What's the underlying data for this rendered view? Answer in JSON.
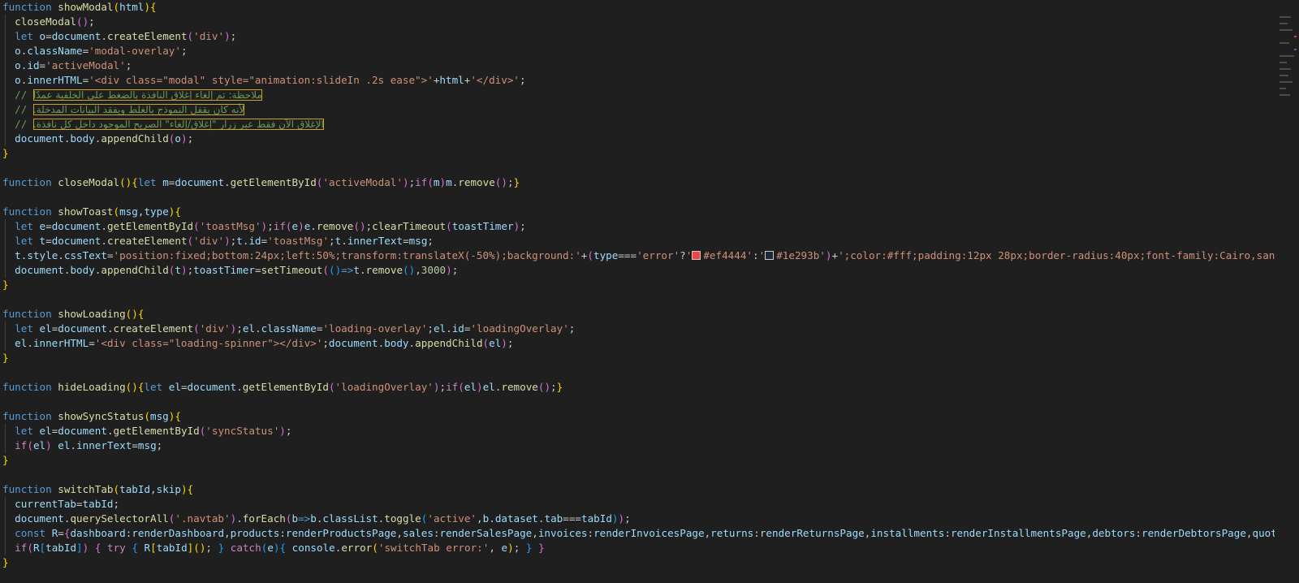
{
  "editor": {
    "language": "javascript",
    "lines": [
      "function showModal(html){",
      "  closeModal();",
      "  let o=document.createElement('div');",
      "  o.className='modal-overlay';",
      "  o.id='activeModal';",
      "  o.innerHTML='<div class=\"modal\" style=\"animation:slideIn .2s ease\">'+html+'</div>';",
      "  // ملاحظة: تم إلغاء إغلاق النافذة بالضغط على الخلفية عمدًا",
      "  // لأنه كان يقفل النموذج بالغلط ويفقد البيانات المدخلة.",
      "  // الإغلاق الآن فقط عبر زرار \"إغلاق/إلغاء\" الصريح الموجود داخل كل نافذة.",
      "  document.body.appendChild(o);",
      "}",
      "",
      "function closeModal(){let m=document.getElementById('activeModal');if(m)m.remove();}",
      "",
      "function showToast(msg,type){",
      "  let e=document.getElementById('toastMsg');if(e)e.remove();clearTimeout(toastTimer);",
      "  let t=document.createElement('div');t.id='toastMsg';t.innerText=msg;",
      "  t.style.cssText='position:fixed;bottom:24px;left:50%;transform:translateX(-50%);background:'+(type==='error'?'#ef4444':'#1e293b')+';color:#fff;padding:12px 28px;border-radius:40px;font-family:Cairo,sans-serif;fo",
      "  document.body.appendChild(t);toastTimer=setTimeout(()=>t.remove(),3000);",
      "}",
      "",
      "function showLoading(){",
      "  let el=document.createElement('div');el.className='loading-overlay';el.id='loadingOverlay';",
      "  el.innerHTML='<div class=\"loading-spinner\"></div>';document.body.appendChild(el);",
      "}",
      "",
      "function hideLoading(){let el=document.getElementById('loadingOverlay');if(el)el.remove();}",
      "",
      "function showSyncStatus(msg){",
      "  let el=document.getElementById('syncStatus');",
      "  if(el) el.innerText=msg;",
      "}",
      "",
      "function switchTab(tabId,skip){",
      "  currentTab=tabId;",
      "  document.querySelectorAll('.navtab').forEach(b=>b.classList.toggle('active',b.dataset.tab===tabId));",
      "  const R={dashboard:renderDashboard,products:renderProductsPage,sales:renderSalesPage,invoices:renderInvoicesPage,returns:renderReturnsPage,installments:renderInstallmentsPage,debtors:renderDebtorsPage,quotes:renderQ",
      "  if(R[tabId]) { try { R[tabId](); } catch(e){ console.error('switchTab error:', e); } }",
      "}"
    ],
    "color_swatches": {
      "error": "#ef4444",
      "default": "#1e293b"
    },
    "theme": {
      "background": "#1f1f1f",
      "keyword": "#569cd6",
      "control": "#c586c0",
      "function": "#dcdcaa",
      "variable": "#9cdcfe",
      "string": "#ce9178",
      "comment": "#6a9955",
      "number": "#b5cea8"
    }
  }
}
